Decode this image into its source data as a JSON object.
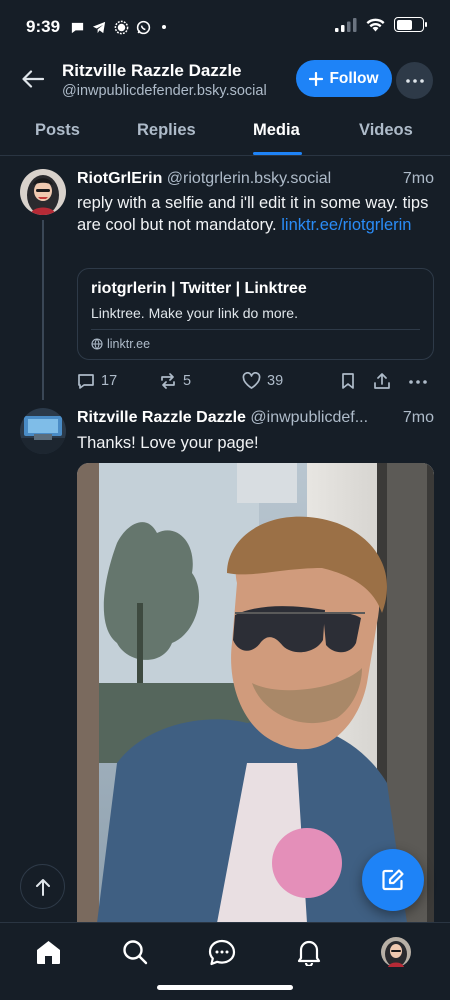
{
  "status_bar": {
    "time": "9:39"
  },
  "header": {
    "profile_name": "Ritzville Razzle Dazzle",
    "profile_handle": "@inwpublicdefender.bsky.social",
    "follow_label": "Follow"
  },
  "tabs": [
    {
      "label": "Posts"
    },
    {
      "label": "Replies"
    },
    {
      "label": "Media",
      "active": true
    },
    {
      "label": "Videos"
    }
  ],
  "posts": [
    {
      "author": "RiotGrlErin",
      "handle": "@riotgrlerin.bsky.social",
      "time": "7mo",
      "text": "reply with a selfie and i'll edit it in some way. tips are cool but not mandatory. ",
      "link_text": "linktr.ee/riotgrlerin",
      "link_card": {
        "title": "riotgrlerin | Twitter | Linktree",
        "description": "Linktree. Make your link do more.",
        "domain": "linktr.ee"
      },
      "replies": "17",
      "reposts": "5",
      "likes": "39"
    },
    {
      "author": "Ritzville Razzle Dazzle",
      "handle": "@inwpublicdef...",
      "time": "7mo",
      "text": "Thanks! Love your page!"
    }
  ],
  "colors": {
    "background": "#161e27",
    "accent": "#1e83f7",
    "muted_text": "#aebbc9",
    "link": "#2a8cf7"
  },
  "icons": [
    "back-arrow-icon",
    "plus-icon",
    "more-horizontal-icon",
    "reply-icon",
    "repost-icon",
    "heart-icon",
    "bookmark-icon",
    "share-icon",
    "globe-icon",
    "arrow-up-icon",
    "compose-icon",
    "home-icon",
    "search-icon",
    "chat-icon",
    "bell-icon"
  ]
}
